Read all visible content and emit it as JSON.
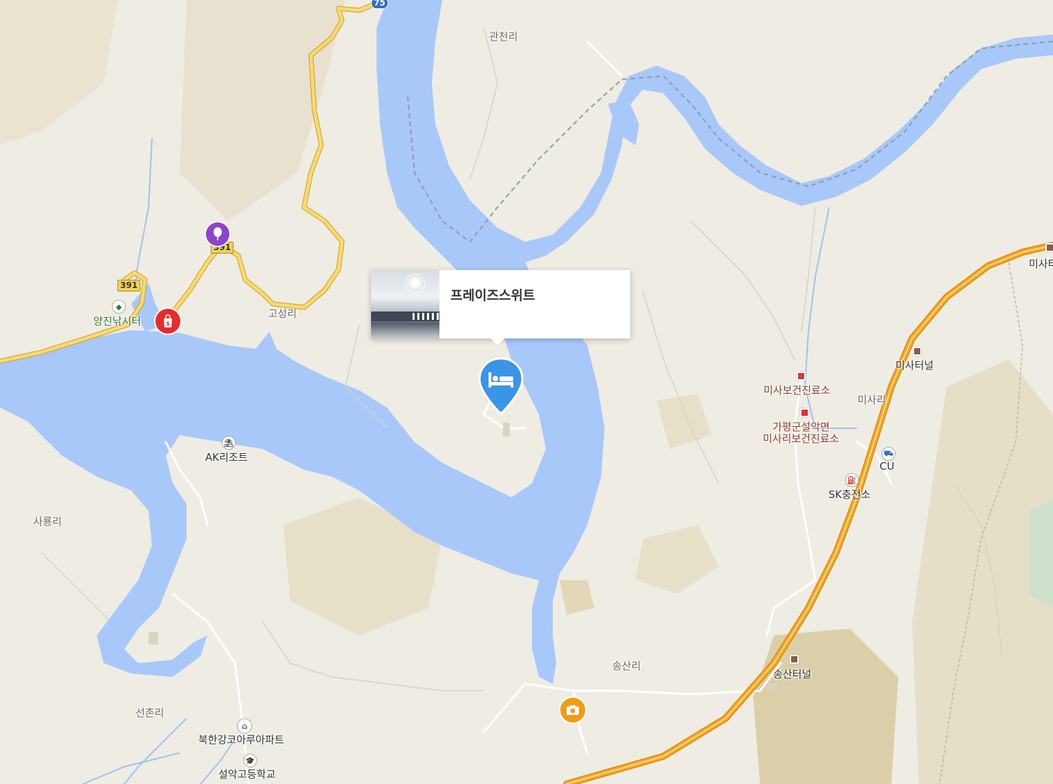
{
  "popup": {
    "title": "프레이즈스위트"
  },
  "markers": {
    "hotel_icon": "bed-icon",
    "camera_icon": "camera-icon",
    "shopping_icon": "shopping-bag-icon",
    "balloon_icon": "balloon-icon"
  },
  "route_shields": {
    "r391_a": "391",
    "r391_b": "391",
    "r75": "75"
  },
  "places": {
    "gwancheon": "관천리",
    "goseong": "고성리",
    "yangjin": "양진낚시터",
    "ak_resort": "AK리조트",
    "saryong": "사룡리",
    "seonchon": "선촌리",
    "bukhangang": "북한강코아루아파트",
    "seorak_high": "설악고등학교",
    "songsan_ri": "송산리",
    "songsan_tunnel": "송산터널",
    "misa_clinic": "미사보건진료소",
    "gapyeong_clinic_1": "가평군설악면",
    "gapyeong_clinic_2": "미사리보건진료소",
    "misa_ri": "미사리",
    "misa_tunnel": "미사터널",
    "misa_edge": "미사터",
    "cu": "CU",
    "sk": "SK충전소"
  },
  "colors": {
    "water": "#a8c8fa",
    "land": "#efece3",
    "hill": "#e3dcc6",
    "highway": "#f5a623",
    "road_yellow": "#f6d365",
    "hotel_pin": "#3b95e6",
    "camera": "#f39b17",
    "shopping": "#e52b2b",
    "balloon": "#8e44c9"
  }
}
